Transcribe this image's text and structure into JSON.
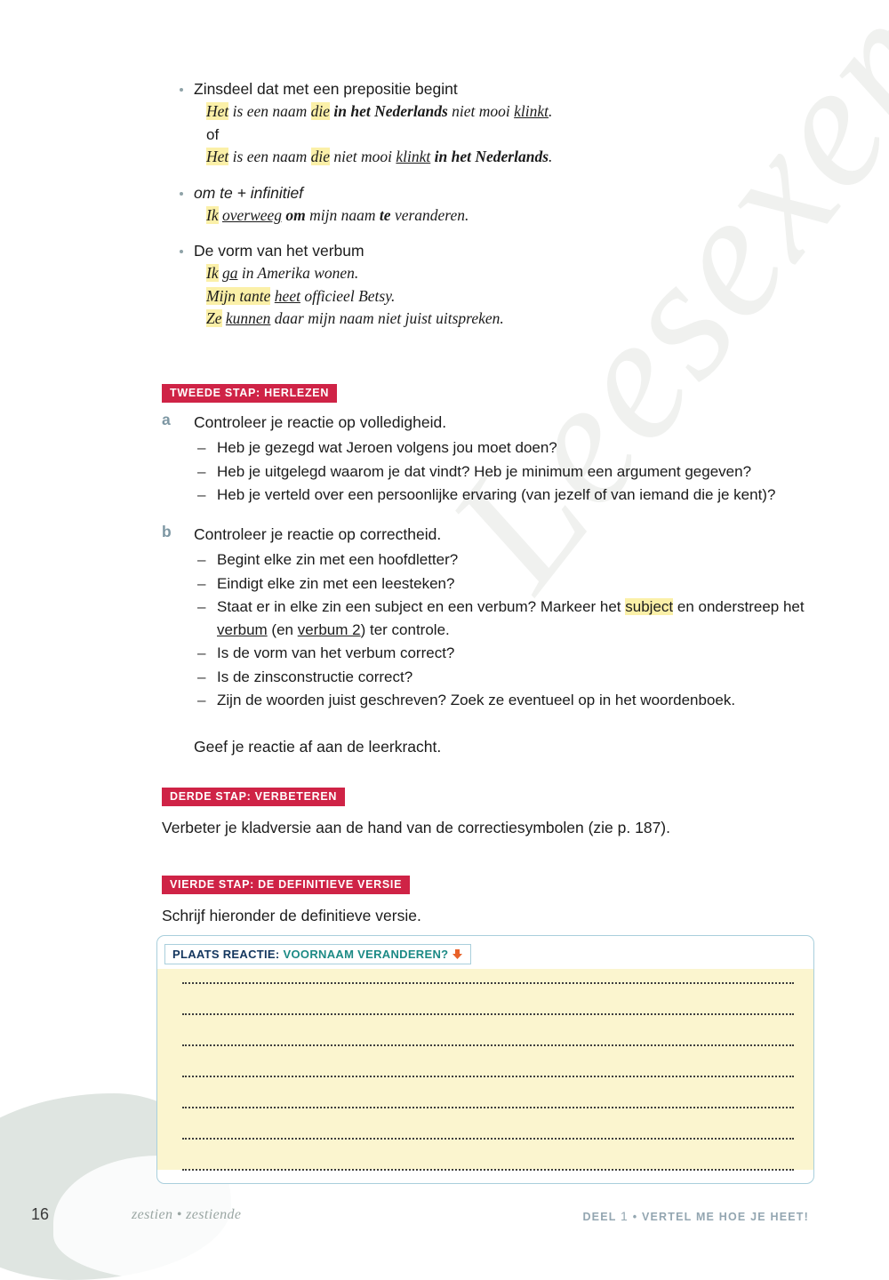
{
  "watermark": {
    "text": "Leesexemplaar"
  },
  "grammar_list": [
    {
      "heading": "Zinsdeel dat met een prepositie begint",
      "italic_heading": false,
      "examples": [
        {
          "type": "rich",
          "parts": [
            {
              "t": "Het",
              "s": "hl-ital"
            },
            {
              "t": " is een naam ",
              "s": "ital"
            },
            {
              "t": "die",
              "s": "hl-ital"
            },
            {
              "t": " ",
              "s": "ital"
            },
            {
              "t": "in het Nederlands",
              "s": "bold-ital"
            },
            {
              "t": " niet mooi ",
              "s": "ital"
            },
            {
              "t": "klinkt",
              "s": "ul-ital"
            },
            {
              "t": ".",
              "s": "ital"
            }
          ]
        },
        {
          "type": "plain",
          "text": "of"
        },
        {
          "type": "rich",
          "parts": [
            {
              "t": "Het",
              "s": "hl-ital"
            },
            {
              "t": " is een naam ",
              "s": "ital"
            },
            {
              "t": "die",
              "s": "hl-ital"
            },
            {
              "t": " niet mooi ",
              "s": "ital"
            },
            {
              "t": "klinkt",
              "s": "ul-ital"
            },
            {
              "t": " ",
              "s": "ital"
            },
            {
              "t": "in het Nederlands",
              "s": "bold-ital"
            },
            {
              "t": ".",
              "s": "ital"
            }
          ]
        }
      ]
    },
    {
      "heading": "om te + infinitief",
      "italic_heading": true,
      "examples": [
        {
          "type": "rich",
          "parts": [
            {
              "t": "Ik",
              "s": "hl-ital"
            },
            {
              "t": " ",
              "s": "ital"
            },
            {
              "t": "overweeg",
              "s": "ul-ital"
            },
            {
              "t": " ",
              "s": "ital"
            },
            {
              "t": "om",
              "s": "bold-ital"
            },
            {
              "t": " mijn naam ",
              "s": "ital"
            },
            {
              "t": "te",
              "s": "bold-ital"
            },
            {
              "t": " veranderen.",
              "s": "ital"
            }
          ]
        }
      ]
    },
    {
      "heading": "De vorm van het verbum",
      "italic_heading": false,
      "examples": [
        {
          "type": "rich",
          "parts": [
            {
              "t": "Ik",
              "s": "hl-ital"
            },
            {
              "t": " ",
              "s": "ital"
            },
            {
              "t": "ga",
              "s": "ul-ital"
            },
            {
              "t": " in Amerika wonen.",
              "s": "ital"
            }
          ]
        },
        {
          "type": "rich",
          "parts": [
            {
              "t": "Mijn tante",
              "s": "hl-ital"
            },
            {
              "t": " ",
              "s": "ital"
            },
            {
              "t": "heet",
              "s": "ul-ital"
            },
            {
              "t": " officieel Betsy.",
              "s": "ital"
            }
          ]
        },
        {
          "type": "rich",
          "parts": [
            {
              "t": "Ze",
              "s": "hl-ital"
            },
            {
              "t": " ",
              "s": "ital"
            },
            {
              "t": "kunnen",
              "s": "ul-ital"
            },
            {
              "t": " daar mijn naam niet juist uitspreken.",
              "s": "ital"
            }
          ]
        }
      ]
    }
  ],
  "step_two": {
    "badge": "TWEEDE STAP: HERLEZEN",
    "tasks": [
      {
        "letter": "a",
        "title": "Controleer je reactie op volledigheid.",
        "items": [
          "Heb je gezegd wat Jeroen volgens jou moet doen?",
          "Heb je uitgelegd waarom je dat vindt? Heb je minimum een argument gegeven?",
          "Heb je verteld over een persoonlijke ervaring (van jezelf of van iemand die je kent)?"
        ]
      },
      {
        "letter": "b",
        "title": "Controleer je reactie op correctheid.",
        "items": [
          "Begint elke zin met een hoofdletter?",
          "Eindigt elke zin met een leesteken?",
          "Is de vorm van het verbum correct?",
          "Is de zinsconstructie correct?",
          "Zijn de woorden juist geschreven? Zoek ze eventueel op in het woordenboek."
        ],
        "rich_item": {
          "pre": "Staat er in elke zin een subject en een verbum? Markeer het ",
          "highlight": "subject",
          "mid": " en onderstreep het ",
          "underline1": "verbum",
          "mid2": " (en ",
          "underline2": "verbum 2",
          "post": ") ter controle."
        },
        "closing": "Geef je reactie af aan de leerkracht."
      }
    ]
  },
  "step_three": {
    "badge": "DERDE STAP: VERBETEREN",
    "text": "Verbeter je kladversie aan de hand van de correctiesymbolen (zie p. 187)."
  },
  "step_four": {
    "badge": "VIERDE STAP: DE DEFINITIEVE VERSIE",
    "text": "Schrijf hieronder de definitieve versie."
  },
  "answer_box": {
    "label_prefix": "PLAATS REACTIE:",
    "label_topic": "VOORNAAM VERANDEREN?",
    "icon": "download-arrow-icon",
    "line_count": 7
  },
  "footer": {
    "page_number": "16",
    "page_words": "zestien • zestiende",
    "section_pre": "DEEL",
    "section_num": "1",
    "section_post": "• VERTEL ME HOE JE HEET!"
  },
  "colors": {
    "badge_red": "#cf2346",
    "highlight_yellow": "#fbf0a8",
    "label_navy": "#13365e",
    "label_teal": "#1c8a85",
    "icon_orange": "#e8622a",
    "box_border_blue": "#a9cfdc",
    "answer_fill": "#fbf5cf",
    "letter_blue": "#7d97a3"
  }
}
